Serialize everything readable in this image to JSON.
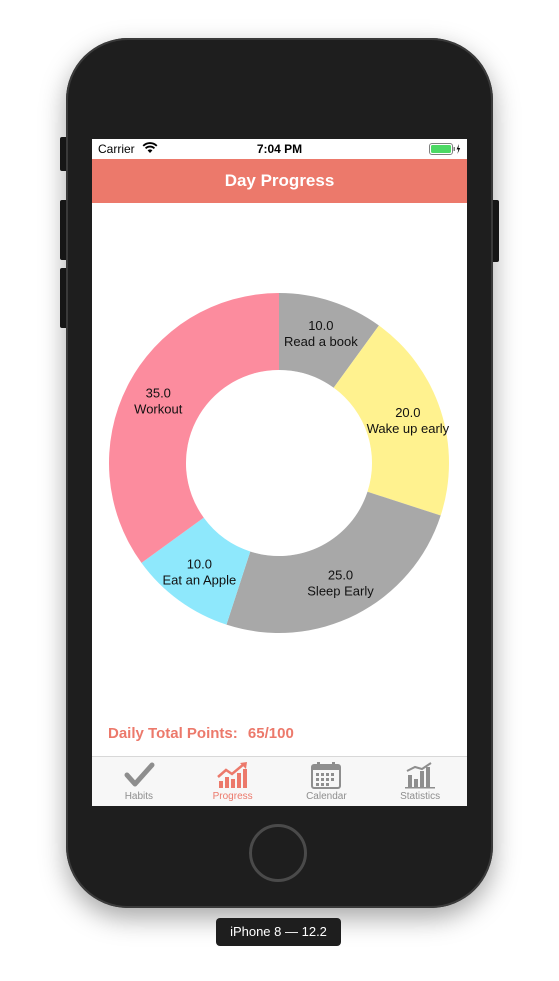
{
  "status_bar": {
    "carrier": "Carrier",
    "time": "7:04 PM"
  },
  "nav": {
    "title": "Day Progress"
  },
  "chart_data": {
    "type": "pie",
    "variant": "donut",
    "slices": [
      {
        "value_label": "10.0",
        "name": "Read a book",
        "value": 10.0,
        "color": "#a8a8a8"
      },
      {
        "value_label": "20.0",
        "name": "Wake up early",
        "value": 20.0,
        "color": "#fff28f"
      },
      {
        "value_label": "25.0",
        "name": "Sleep Early",
        "value": 25.0,
        "color": "#a8a8a8"
      },
      {
        "value_label": "10.0",
        "name": "Eat an Apple",
        "value": 10.0,
        "color": "#8ee8fc"
      },
      {
        "value_label": "35.0",
        "name": "Workout",
        "value": 35.0,
        "color": "#fc8c9e"
      }
    ]
  },
  "summary": {
    "label": "Daily Total Points:",
    "value": "65/100"
  },
  "tabs": [
    {
      "label": "Habits",
      "icon": "checkmark-icon",
      "active": false
    },
    {
      "label": "Progress",
      "icon": "progress-chart-icon",
      "active": true
    },
    {
      "label": "Calendar",
      "icon": "calendar-icon",
      "active": false
    },
    {
      "label": "Statistics",
      "icon": "bar-chart-icon",
      "active": false
    }
  ],
  "device": {
    "label": "iPhone 8 — 12.2"
  },
  "colors": {
    "accent": "#ec796b",
    "tab_inactive": "#8e8e8e"
  }
}
